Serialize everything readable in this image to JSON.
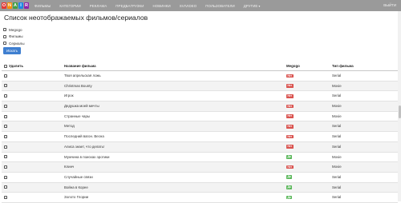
{
  "navbar": {
    "logo_letters": [
      {
        "letter": "O",
        "color": "#e53935"
      },
      {
        "letter": "N",
        "color": "#fb8c00"
      },
      {
        "letter": "A",
        "color": "#43a047"
      },
      {
        "letter": "I",
        "color": "#1e88e5"
      },
      {
        "letter": "R",
        "color": "#8e24aa"
      }
    ],
    "items": [
      "ФИЛЬМЫ",
      "КАТЕГОРИИ",
      "РЕКЛАМА",
      "ПРЕДБАГРУЗКИ",
      "НОВИНКИ",
      "SVIVIDEO",
      "ПОЛЬЗОВАТЕЛИ",
      "ДРУГИЕ"
    ],
    "exit_label": "ВЫЙТИ"
  },
  "page": {
    "title": "Список неотображаемых фильмов/сериалов",
    "filters": [
      "Megogo",
      "Фильмы",
      "Сериалы"
    ],
    "search_button": "Искать"
  },
  "table": {
    "headers": {
      "delete": "Удалить",
      "name": "Название фильма",
      "megogo": "Megogo",
      "type": "Тип фильма"
    },
    "rows": [
      {
        "name": "Твоя апрельская ложь",
        "megogo": "Нет",
        "type": "Serial"
      },
      {
        "name": "Christmas Bounty",
        "megogo": "Нет",
        "type": "Movie"
      },
      {
        "name": "Игрок",
        "megogo": "Нет",
        "type": "Serial"
      },
      {
        "name": "Дедушка моей мечты",
        "megogo": "Нет",
        "type": "Movie"
      },
      {
        "name": "Странные чары",
        "megogo": "Нет",
        "type": "Movie"
      },
      {
        "name": "Метод",
        "megogo": "Нет",
        "type": "Serial"
      },
      {
        "name": "Последний вагон. Весна",
        "megogo": "Нет",
        "type": "Serial"
      },
      {
        "name": "Алиса знает, что делать!",
        "megogo": "Нет",
        "type": "Serial"
      },
      {
        "name": "Мужчина в поисках эротики",
        "megogo": "Да",
        "type": "Movie"
      },
      {
        "name": "Клинч",
        "megogo": "Нет",
        "type": "Movie"
      },
      {
        "name": "Случайные связи",
        "megogo": "Да",
        "type": "Serial"
      },
      {
        "name": "Война в Корее",
        "megogo": "Да",
        "type": "Serial"
      },
      {
        "name": "Золото Глории",
        "megogo": "Да",
        "type": "Serial"
      }
    ]
  }
}
